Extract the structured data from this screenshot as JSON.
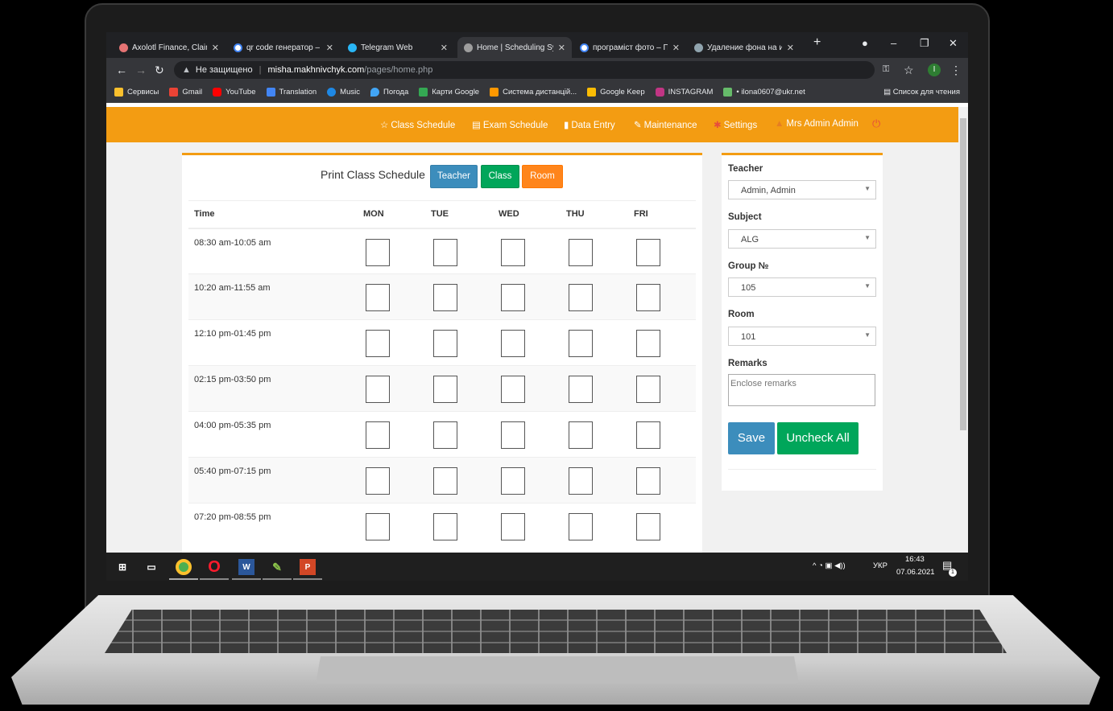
{
  "browser": {
    "tabs": [
      {
        "title": "Axolotl Finance, Claim",
        "color": "#e57373"
      },
      {
        "title": "qr code генератор – ",
        "color": "#ffffff"
      },
      {
        "title": "Telegram Web",
        "color": "#29b6f6"
      },
      {
        "title": "Home | Scheduling Sy",
        "color": "#9e9e9e"
      },
      {
        "title": "програміст фото – По",
        "color": "#ffffff"
      },
      {
        "title": "Удаление фона на из",
        "color": "#90a4ae"
      }
    ],
    "address": {
      "security": "Не защищено",
      "host": "misha.makhnivchyk.com",
      "path": "/pages/home.php"
    },
    "profile_initial": "I",
    "bookmarks": [
      {
        "label": "Сервисы",
        "color": "#fbc02d"
      },
      {
        "label": "Gmail",
        "color": "#ea4335"
      },
      {
        "label": "YouTube",
        "color": "#ff0000"
      },
      {
        "label": "Translation",
        "color": "#4285f4"
      },
      {
        "label": "Music",
        "color": "#1e88e5"
      },
      {
        "label": "Погода",
        "color": "#42a5f5"
      },
      {
        "label": "Карти Google",
        "color": "#34a853"
      },
      {
        "label": "Система дистанцій...",
        "color": "#ff9800"
      },
      {
        "label": "Google Keep",
        "color": "#fbbc04"
      },
      {
        "label": "INSTAGRAM",
        "color": "#c13584"
      },
      {
        "label": "• ilona0607@ukr.net",
        "color": "#66bb6a"
      }
    ],
    "reading_list": "Список для чтения"
  },
  "app_nav": {
    "class_schedule": "Class Schedule",
    "exam_schedule": "Exam Schedule",
    "data_entry": "Data Entry",
    "maintenance": "Maintenance",
    "settings": "Settings",
    "user": "Mrs Admin Admin"
  },
  "schedule": {
    "title": "Print Class Schedule",
    "buttons": {
      "teacher": "Teacher",
      "class": "Class",
      "room": "Room"
    },
    "columns": [
      "Time",
      "MON",
      "TUE",
      "WED",
      "THU",
      "FRI"
    ],
    "rows": [
      "08:30 am-10:05 am",
      "10:20 am-11:55 am",
      "12:10 pm-01:45 pm",
      "02:15 pm-03:50 pm",
      "04:00 pm-05:35 pm",
      "05:40 pm-07:15 pm",
      "07:20 pm-08:55 pm"
    ]
  },
  "form": {
    "teacher_label": "Teacher",
    "teacher_value": "Admin, Admin",
    "subject_label": "Subject",
    "subject_value": "ALG",
    "group_label": "Group №",
    "group_value": "105",
    "room_label": "Room",
    "room_value": "101",
    "remarks_label": "Remarks",
    "remarks_placeholder": "Enclose remarks",
    "save": "Save",
    "uncheck_all": "Uncheck All"
  },
  "taskbar": {
    "apps": [
      "windows-start",
      "task-view",
      "chrome",
      "opera",
      "word",
      "paint",
      "powerpoint"
    ],
    "lang": "УКР",
    "time": "16:43",
    "date": "07.06.2021",
    "notifications": "1"
  },
  "colors": {
    "accent": "#f39c12",
    "blue": "#3c8dbc",
    "green": "#00a65a",
    "orange": "#ff851b"
  }
}
